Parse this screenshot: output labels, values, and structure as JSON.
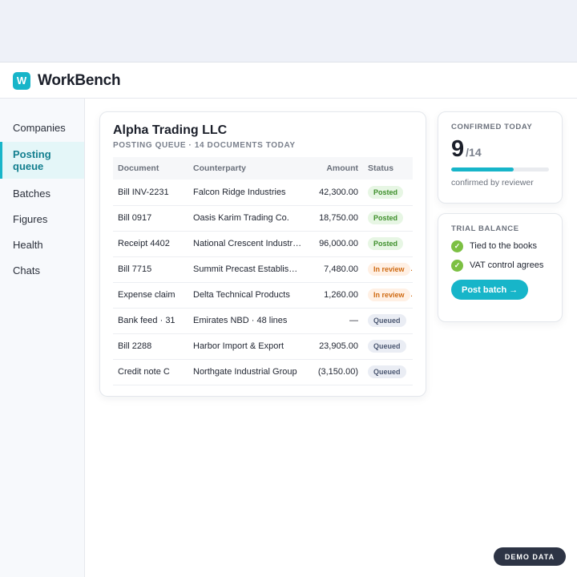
{
  "app": {
    "title": "WorkBench",
    "logo_letter": "W"
  },
  "sidebar": {
    "items": [
      {
        "label": "Companies",
        "active": false
      },
      {
        "label": "Posting queue",
        "active": true
      },
      {
        "label": "Batches",
        "active": false
      },
      {
        "label": "Figures",
        "active": false
      },
      {
        "label": "Health",
        "active": false
      },
      {
        "label": "Chats",
        "active": false
      }
    ]
  },
  "main": {
    "company": "Alpha Trading LLC",
    "subtitle": "POSTING QUEUE · 14 DOCUMENTS TODAY",
    "columns": [
      "Document",
      "Counterparty",
      "Amount",
      "Status"
    ],
    "rows": [
      {
        "document": "Bill INV-2231",
        "counterparty": "Falcon Ridge Industries",
        "amount": "42,300.00",
        "status": "Posted",
        "status_kind": "posted"
      },
      {
        "document": "Bill 0917",
        "counterparty": "Oasis Karim Trading Co.",
        "amount": "18,750.00",
        "status": "Posted",
        "status_kind": "posted"
      },
      {
        "document": "Receipt 4402",
        "counterparty": "National Crescent Industries",
        "amount": "96,000.00",
        "status": "Posted",
        "status_kind": "posted"
      },
      {
        "document": "Bill 7715",
        "counterparty": "Summit Precast Establishment",
        "amount": "7,480.00",
        "status": "In review",
        "status_kind": "review"
      },
      {
        "document": "Expense claim",
        "counterparty": "Delta Technical Products",
        "amount": "1,260.00",
        "status": "In review",
        "status_kind": "review"
      },
      {
        "document": "Bank feed · 31",
        "counterparty": "Emirates NBD · 48 lines",
        "amount": "—",
        "status": "Queued",
        "status_kind": "queued"
      },
      {
        "document": "Bill 2288",
        "counterparty": "Harbor Import & Export",
        "amount": "23,905.00",
        "status": "Queued",
        "status_kind": "queued"
      },
      {
        "document": "Credit note C",
        "counterparty": "Northgate Industrial Group",
        "amount": "(3,150.00)",
        "status": "Queued",
        "status_kind": "queued"
      }
    ]
  },
  "confirmed": {
    "label": "CONFIRMED TODAY",
    "count": "9",
    "total": "/14",
    "progress_fraction": 0.64,
    "caption": "confirmed by reviewer"
  },
  "trial_balance": {
    "label": "TRIAL BALANCE",
    "checks": [
      "Tied to the books",
      "VAT control agrees"
    ],
    "button_label": "Post batch →"
  },
  "demo_badge": "DEMO DATA",
  "colors": {
    "accent": "#17b5c9",
    "check": "#7cc043",
    "posted": "#3e8f2b",
    "review": "#cf6a12",
    "queued": "#4c5872"
  }
}
